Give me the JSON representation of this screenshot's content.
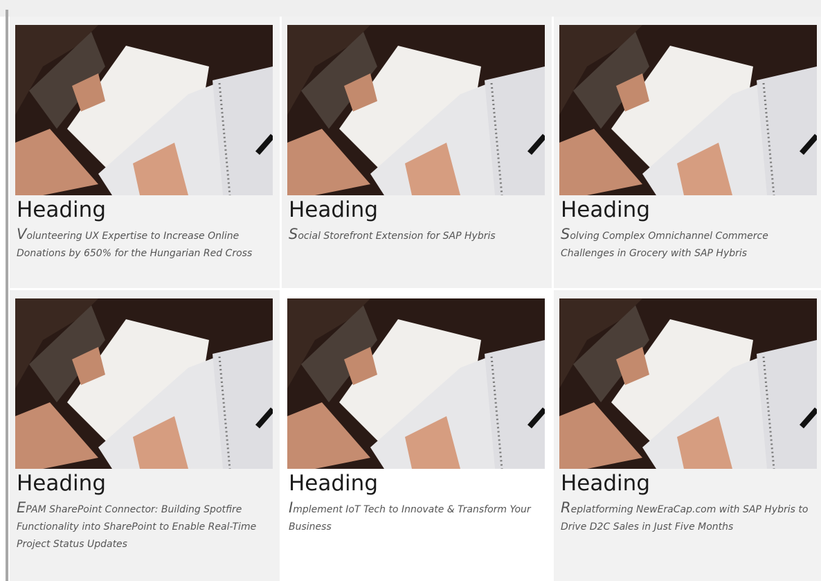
{
  "cards": [
    {
      "heading": "Heading",
      "description": "Volunteering UX Expertise to Increase Online Donations by 650% for the Hungarian Red Cross",
      "bg": "#f2f2f2"
    },
    {
      "heading": "Heading",
      "description": "Social Storefront Extension for SAP Hybris",
      "bg": "#f1f1f1"
    },
    {
      "heading": "Heading",
      "description": "Solving Complex Omnichannel Commerce Challenges in Grocery with SAP Hybris",
      "bg": "#f2f2f2"
    },
    {
      "heading": "Heading",
      "description": "EPAM SharePoint Connector: Building Spotfire Functionality into SharePoint to Enable Real-Time Project Status Updates",
      "bg": "#f1f1f1"
    },
    {
      "heading": "Heading",
      "description": "Implement IoT Tech to Innovate & Transform Your Business",
      "bg": "#ffffff"
    },
    {
      "heading": "Heading",
      "description": "Replatforming NewEraCap.com with SAP Hybris to Drive D2C Sales in Just Five Months",
      "bg": "#f2f2f2"
    }
  ],
  "image": {
    "alt": "open-book-photo"
  }
}
